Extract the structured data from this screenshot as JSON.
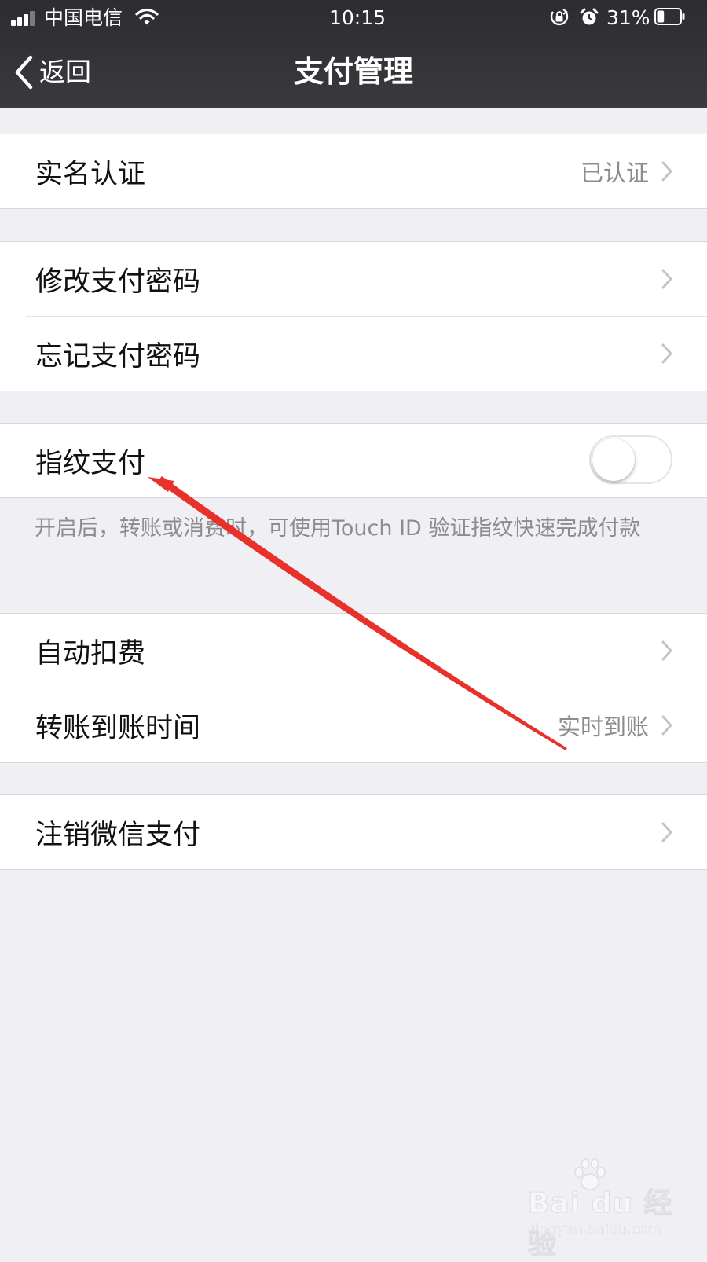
{
  "status_bar": {
    "carrier": "中国电信",
    "time": "10:15",
    "battery_percent": "31%",
    "battery_level": 0.31,
    "icons": [
      "signal-icon",
      "wifi-icon",
      "rotation-lock-icon",
      "alarm-icon",
      "battery-icon"
    ]
  },
  "nav": {
    "back_label": "返回",
    "title": "支付管理"
  },
  "sections": {
    "realname": {
      "label": "实名认证",
      "value": "已认证"
    },
    "change_password": {
      "label": "修改支付密码"
    },
    "forgot_password": {
      "label": "忘记支付密码"
    },
    "fingerprint": {
      "label": "指纹支付",
      "enabled": false,
      "footnote": "开启后，转账或消费时，可使用Touch ID 验证指纹快速完成付款"
    },
    "auto_deduct": {
      "label": "自动扣费"
    },
    "transfer_time": {
      "label": "转账到账时间",
      "value": "实时到账"
    },
    "cancel_wechat_pay": {
      "label": "注销微信支付"
    }
  },
  "annotation": {
    "type": "red-arrow",
    "color": "#e8312a"
  },
  "watermark": {
    "logo_text": "Bai du 经验",
    "url": "jingyan.baidu.com"
  },
  "colors": {
    "nav_background": "#333337",
    "page_background": "#efeff4",
    "secondary_text": "#8c8c8f"
  }
}
